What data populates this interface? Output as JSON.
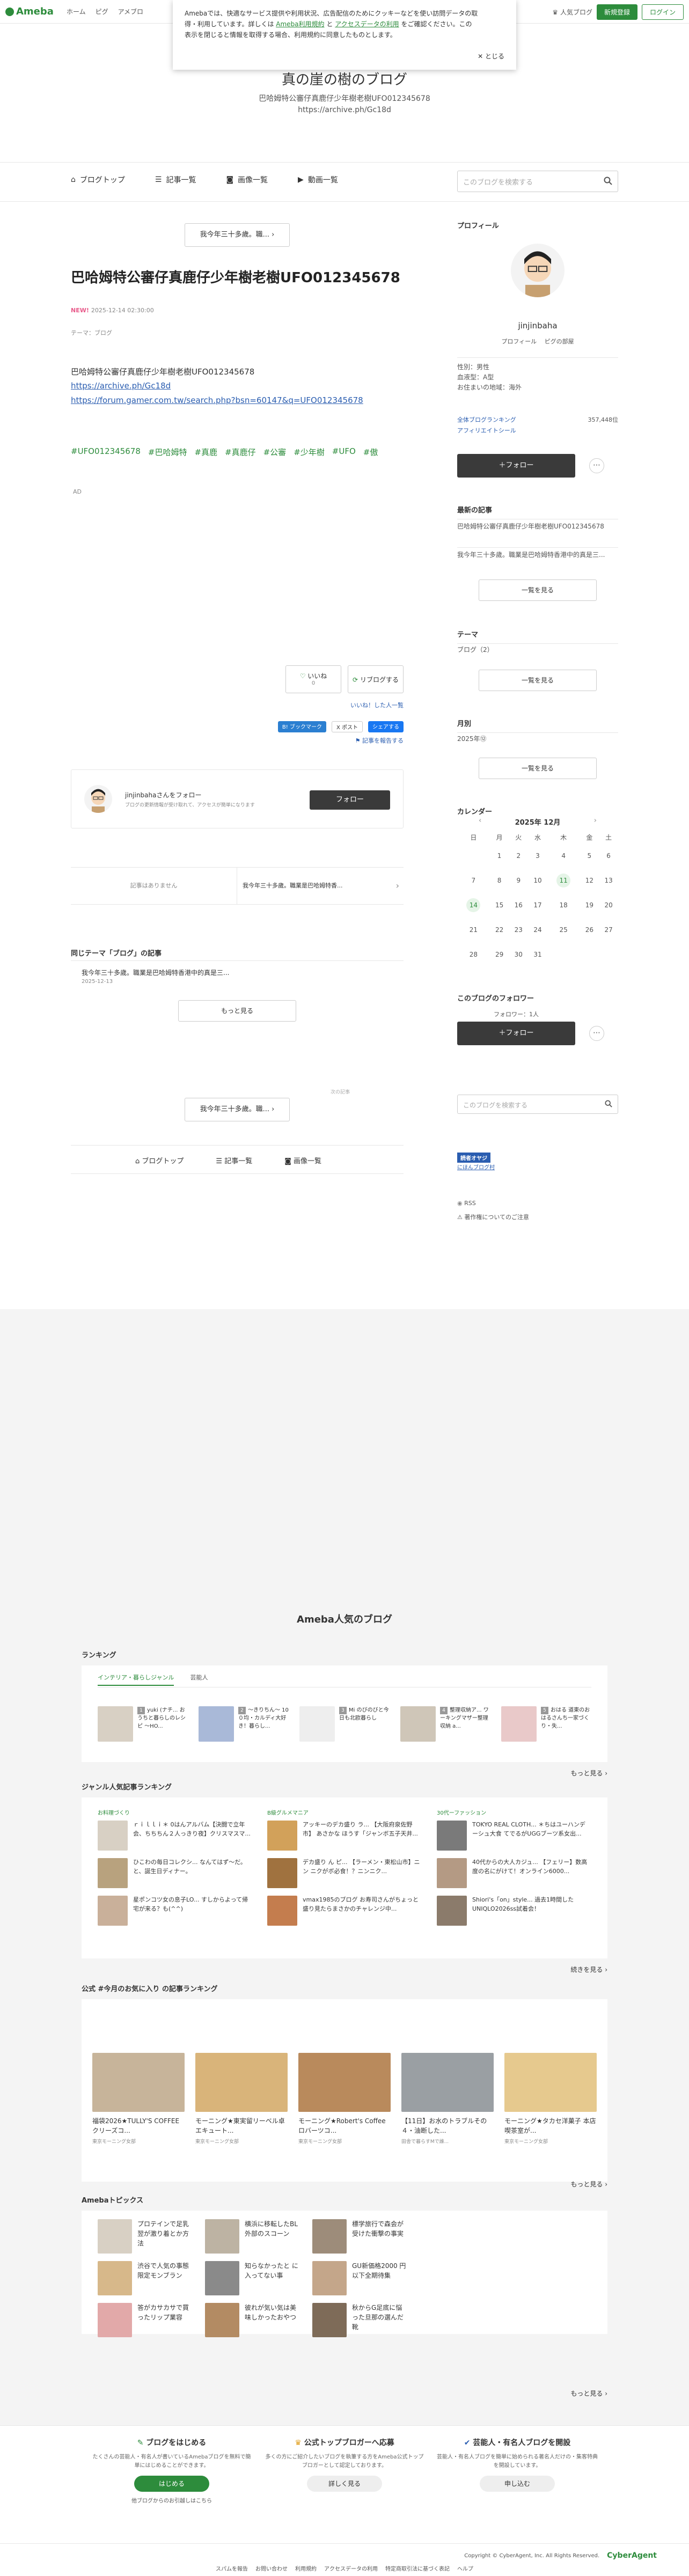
{
  "topbar": {
    "logo": "Ameba",
    "nav": [
      "ホーム",
      "ピグ",
      "アメブロ"
    ],
    "right_link": "人気ブログ",
    "signup": "新規登録",
    "login": "ログイン"
  },
  "cookie": {
    "line1": "Amebaでは、快適なサービス提供や利用状況、広告配信のためにクッキーなどを使い訪問データの取",
    "line2": "得・利用しています。詳しくは",
    "link1": "Ameba利用規約",
    "and": "と",
    "link2": "アクセスデータの利用",
    "line2b": "をご確認ください。この",
    "line3": "表示を閉じると情報を取得する場合、利用規約に同意したものとします。",
    "close": "とじる"
  },
  "blog": {
    "title": "真の崖の樹のブログ",
    "desc": "巴哈姆特公審仔真鹿仔少年樹老樹UFO012345678",
    "url": "https://archive.ph/Gc18d"
  },
  "blognav": {
    "items": [
      "ブログトップ",
      "記事一覧",
      "画像一覧",
      "動画一覧"
    ],
    "search_placeholder": "このブログを検索する"
  },
  "article": {
    "prev_btn": "我今年三十多歲。職...",
    "title": "巴哈姆特公審仔真鹿仔少年樹老樹UFO012345678",
    "new": "NEW!",
    "date": "2025-12-14 02:30:00",
    "theme": "テーマ：ブログ",
    "body1": "巴哈姆特公審仔真鹿仔少年樹老樹UFO012345678",
    "link1": "https://archive.ph/Gc18d",
    "link2": "https://forum.gamer.com.tw/search.php?bsn=60147&q=UFO012345678",
    "tags": [
      "#UFO012345678",
      "#巴哈姆特",
      "#真鹿",
      "#真鹿仔",
      "#公審",
      "#少年樹",
      "#UFO",
      "#傲"
    ],
    "ad": "AD",
    "like": "いいね",
    "like_count": "0",
    "reblog": "リブログする",
    "like_list": "いいね！した人一覧",
    "share_hatena": "B! ブックマーク",
    "share_x": "X ポスト",
    "share_fb": "シェアする",
    "report": "記事を報告する",
    "follow_name": "jinjinbahaさんをフォロー",
    "follow_desc": "ブログの更新情報が受け取れて、アクセスが簡単になります",
    "follow_btn": "フォロー",
    "prev_none": "記事はありません",
    "next_title": "我今年三十多歲。職業是巴哈姆特香...",
    "same_theme_label": "同じテーマ「ブログ」の記事",
    "same_theme_title": "我今年三十多歲。職業是巴哈姆特香港中的真是三...",
    "same_theme_date": "2025-12-13",
    "more": "もっと見る",
    "ad_label": "次の記事",
    "bottom_nav": [
      "ブログトップ",
      "記事一覧",
      "画像一覧"
    ]
  },
  "sidebar": {
    "profile_h": "プロフィール",
    "name": "jinjinbaha",
    "profile_link": "プロフィール",
    "pigg_link": "ピグの部屋",
    "sex": "性別：男性",
    "blood": "血液型：A型",
    "home": "お住まいの地域：海外",
    "ranking": "全体ブログランキング",
    "ranking_val": "357,448位",
    "aff": "アフィリエイトシール",
    "follow": "＋フォロー",
    "recent_h": "最新の記事",
    "recent1": "巴哈姆特公審仔真鹿仔少年樹老樹UFO012345678",
    "recent2": "我今年三十多歲。職業是巴哈姆特香港中的真是三...",
    "list_btn": "一覧を見る",
    "theme_h": "テーマ",
    "theme1": "ブログ（2）",
    "month_h": "月別",
    "month1": "2025年⑫",
    "cal_h": "カレンダー",
    "cal_title": "2025年 12月",
    "cal_dow": [
      "日",
      "月",
      "火",
      "水",
      "木",
      "金",
      "土"
    ],
    "cal_rows": [
      [
        "",
        "1",
        "2",
        "3",
        "4",
        "5",
        "6"
      ],
      [
        "7",
        "8",
        "9",
        "10",
        "11",
        "12",
        "13"
      ],
      [
        "14",
        "15",
        "16",
        "17",
        "18",
        "19",
        "20"
      ],
      [
        "21",
        "22",
        "23",
        "24",
        "25",
        "26",
        "27"
      ],
      [
        "28",
        "29",
        "30",
        "31",
        "",
        "",
        ""
      ]
    ],
    "follower_h": "このブログのフォロワー",
    "follower_count": "フォロワー：1人",
    "search_placeholder": "このブログを検索する",
    "badge_line1": "読者オヤジ",
    "badge_line2": "にほんブログ村",
    "rss": "RSS",
    "copyright": "著作権についてのご注意"
  },
  "popular": {
    "title": "Ameba人気のブログ",
    "ranking_label": "ランキング",
    "tabs": [
      "インテリア・暮らしジャンル",
      "芸能人"
    ],
    "rank_items": [
      {
        "n": "1",
        "t": "yuki (ナチ... おうちと暮らしのレシピ ～HO..."
      },
      {
        "n": "2",
        "t": "～きりちん～ 10０均・カルディ大好き！暮らし..."
      },
      {
        "n": "3",
        "t": "Mi のびのびと今日も北欧暮らし"
      },
      {
        "n": "4",
        "t": "整理収納ア... ワーキングマザー整理収納 a..."
      },
      {
        "n": "5",
        "t": "おはる 道東のおはるさんち一家づくり・失..."
      }
    ],
    "more": "もっと見る",
    "genre_label": "ジャンル人気記事ランキング",
    "genre_cols": [
      {
        "h": "お料理づくり",
        "items": [
          "ｒｉｌｌｉ＊ 0はんアルバム【決闘で立年会、ちちちん２人っきり夜】クリスマスマ...",
          "ひこわの毎日コレクシ... なんてはず〜だ。と、誕生日ディナー。",
          "星ポンコツ女の息子LO... すしからよって帰宅が来る？も(^^)"
        ]
      },
      {
        "h": "B級グルメマニア",
        "items": [
          "アッキーのデカ盛り ラ... 【大阪府泉佐野市】 あさかな ほうす「ジャンボ五子天井...",
          "デカ盛り ん ピ... 【ラーメン・東松山市】ニン ニクがボ必食！？ニンニク...",
          "vmax1985のブログ お寿司さんがちょっと盛り見たらまさかのチャレンジ中..."
        ]
      },
      {
        "h": "30代ーファッション",
        "items": [
          "TOKYO REAL CLOTH... ＊ちはユーハンデーシュ大食 てでるがUGGブーツ系女出...",
          "40代からの大人カジュ... 【フェリー】数高度の名にがけて！オンライン6000...",
          "Shiori's「on」style... 過去1時間した UNIQLO2026ss試着会！"
        ]
      }
    ],
    "genre_more": "続きを見る",
    "official_label": "公式 #今月のお気に入り の記事ランキング",
    "official_items": [
      {
        "t": "福袋2026★TULLY'S COFFEE クリーズコ...",
        "a": "東京モーニング女部"
      },
      {
        "t": "モーニング★東実留リーベル卓エキュート...",
        "a": "東京モーニング女部"
      },
      {
        "t": "モーニング★Robert's Coffee ロバーツコ...",
        "a": "東京モーニング女部"
      },
      {
        "t": "【11日】お水のトラブルその４・油断した...",
        "a": "田舎で暮らすMで誰..."
      },
      {
        "t": "モーニング★タカセ洋菓子 本店 喫茶室が...",
        "a": "東京モーニング女部"
      }
    ],
    "official_more": "もっと見る",
    "topics_label": "Amebaトピックス",
    "topics": [
      "プロテインで足乳 翌が激り着とか方法",
      "横浜に移転したBL 外部のスコーン",
      "標学旅行で森会が 受けた衝撃の事実",
      "渋谷で人気の事態 限定モンブラン",
      "知らなかったと に入ってない事",
      "GU新価格2000 円以下全期待集",
      "答がカサカサで買 ったリップ業容",
      "彼れが気い気は美 味しかったおやつ",
      "秋からG足底に悩 った旦那の選んだ 靴"
    ],
    "topics_more": "もっと見る"
  },
  "cta": [
    {
      "h": "ブログをはじめる",
      "p": "たくさんの芸能人・有名人が書いているAmebaブログを無料で簡単にはじめることができます。",
      "b": "はじめる",
      "sub": "他ブログからのお引越しはこちら"
    },
    {
      "h": "公式トップブロガーへ応募",
      "p": "多くの方にご紹介したいブログを執筆する方をAmeba公式トップブロガーとして認定しております。",
      "b": "詳しく見る",
      "sub": ""
    },
    {
      "h": "芸能人・有名人ブログを開設",
      "p": "芸能人・有名人ブログを簡単に始められる著名人だけの・集客特典を開設しています。",
      "b": "申し込む",
      "sub": ""
    }
  ],
  "bottombar": {
    "links": [
      "スパムを報告",
      "お問い合わせ",
      "利用規約",
      "アクセスデータの利用",
      "特定商取引法に基づく表記",
      "ヘルプ"
    ],
    "copyright": "Copyright © CyberAgent, Inc. All Rights Reserved.",
    "ca": "CyberAgent"
  },
  "colors": {
    "accent": "#2d8c3c",
    "link": "#2a5db0"
  }
}
